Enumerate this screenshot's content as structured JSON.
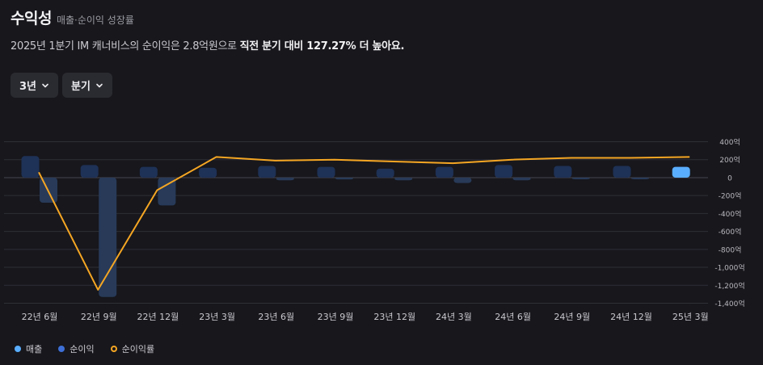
{
  "header": {
    "title": "수익성",
    "subtitle": "매출·순이익 성장률"
  },
  "description": {
    "prefix": "2025년 1분기 IM 캐너비스의 순이익은 2.8억원으로 ",
    "highlight": "직전 분기 대비 127.27% 더 높아요."
  },
  "filters": {
    "period": {
      "label": "3년",
      "icon": "chevron-down-icon"
    },
    "interval": {
      "label": "분기",
      "icon": "chevron-down-icon"
    }
  },
  "colors": {
    "revenue": "#1e3156",
    "revenue_latest": "#5aaeff",
    "net_income": "#283a58",
    "net_income_legend": "#3d6fd6",
    "rate_line": "#f5a623"
  },
  "chart_data": {
    "type": "bar",
    "categories": [
      "22년 6월",
      "22년 9월",
      "22년 12월",
      "23년 3월",
      "23년 6월",
      "23년 9월",
      "23년 12월",
      "24년 3월",
      "24년 6월",
      "24년 9월",
      "24년 12월",
      "25년 3월"
    ],
    "series": [
      {
        "name": "매출",
        "type": "bar",
        "values": [
          240,
          140,
          120,
          110,
          130,
          120,
          100,
          120,
          140,
          130,
          130,
          120
        ]
      },
      {
        "name": "순이익",
        "type": "bar",
        "values": [
          -280,
          -1330,
          -310,
          0,
          -30,
          -20,
          -30,
          -60,
          -30,
          -10,
          -10,
          0
        ]
      },
      {
        "name": "순이익률",
        "type": "line",
        "values": [
          60,
          -1250,
          -140,
          230,
          190,
          200,
          180,
          160,
          200,
          220,
          220,
          230
        ]
      }
    ],
    "y_ticks": [
      "400억",
      "200억",
      "0",
      "-200억",
      "-400억",
      "-600억",
      "-800억",
      "-1,000억",
      "-1,200억",
      "-1,400억"
    ],
    "ylim": [
      -1400,
      400
    ],
    "y_axis_position": "right",
    "grid": true,
    "legend_position": "bottom-left"
  }
}
